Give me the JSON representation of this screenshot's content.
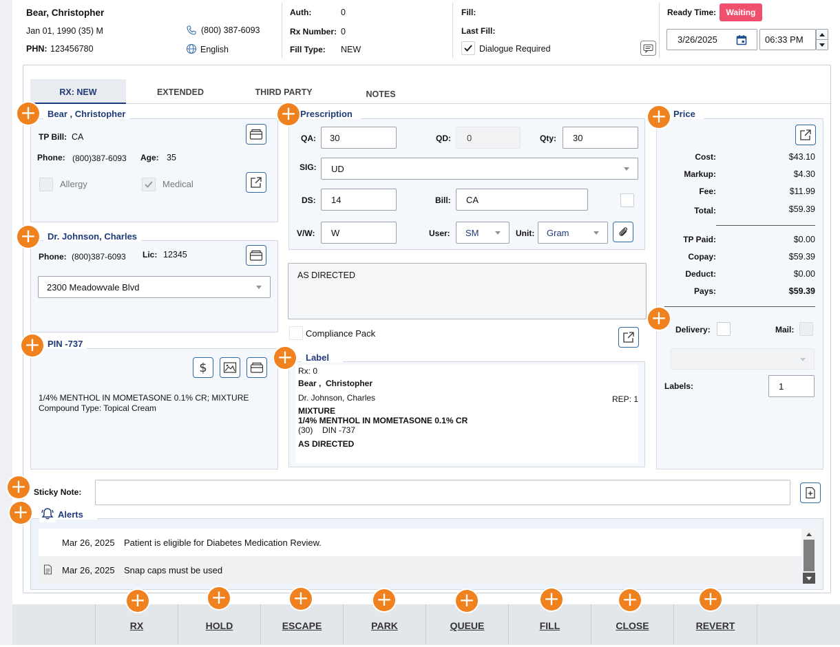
{
  "patient": {
    "name": "Bear, Christopher",
    "dob": "Jan 01, 1990 (35) M",
    "phn_label": "PHN:",
    "phn": "123456780",
    "phone": "(800) 387-6093",
    "language": "English"
  },
  "auth": {
    "auth_label": "Auth:",
    "auth": "0",
    "rx_label": "Rx Number:",
    "rx": "0",
    "filltype_label": "Fill Type:",
    "filltype": "NEW"
  },
  "fill": {
    "fill_label": "Fill:",
    "lastfill_label": "Last Fill:",
    "dialogue_label": "Dialogue Required"
  },
  "ready": {
    "label": "Ready Time:",
    "status": "Waiting",
    "date": "3/26/2025",
    "time": "06:33 PM"
  },
  "tabs": [
    "RX: NEW",
    "EXTENDED",
    "THIRD PARTY",
    "NOTES"
  ],
  "patient_panel": {
    "title": "Bear , Christopher",
    "tpbill_label": "TP Bill:",
    "tpbill": "CA",
    "phone_label": "Phone:",
    "phone": "(800)387-6093",
    "age_label": "Age:",
    "age": "35",
    "allergy": "Allergy",
    "medical": "Medical"
  },
  "doctor_panel": {
    "title": "Dr. Johnson, Charles",
    "phone_label": "Phone:",
    "phone": "(800)387-6093",
    "lic_label": "Lic:",
    "lic": "12345",
    "address": "2300 Meadowvale Blvd"
  },
  "pin_panel": {
    "title": "PIN -737",
    "desc": "1/4% MENTHOL IN MOMETASONE 0.1% CR; MIXTURE",
    "compound": "Compound Type: Topical Cream"
  },
  "prescription": {
    "title": "Prescription",
    "qa_label": "QA:",
    "qa": "30",
    "qd_label": "QD:",
    "qd": "0",
    "qty_label": "Qty:",
    "qty": "30",
    "sig_label": "SIG:",
    "sig": "UD",
    "ds_label": "DS:",
    "ds": "14",
    "bill_label": "Bill:",
    "bill": "CA",
    "vw_label": "V/W:",
    "vw": "W",
    "user_label": "User:",
    "user": "SM",
    "unit_label": "Unit:",
    "unit": "Gram",
    "directions": "AS DIRECTED",
    "compliance": "Compliance Pack"
  },
  "label": {
    "title": "Label",
    "rx": "Rx: 0",
    "patient": "Bear ,  Christopher",
    "doctor": "Dr. Johnson, Charles",
    "rep": "REP: 1",
    "line1": "MIXTURE",
    "line2": "1/4% MENTHOL IN MOMETASONE 0.1% CR",
    "qty": "(30)",
    "din": "DIN -737",
    "directions": "AS DIRECTED"
  },
  "price": {
    "title": "Price",
    "rows1": [
      {
        "label": "Cost:",
        "value": "$43.10"
      },
      {
        "label": "Markup:",
        "value": "$4.30"
      },
      {
        "label": "Fee:",
        "value": "$11.99"
      },
      {
        "label": "Total:",
        "value": "$59.39"
      }
    ],
    "rows2": [
      {
        "label": "TP Paid:",
        "value": "$0.00"
      },
      {
        "label": "Copay:",
        "value": "$59.39"
      },
      {
        "label": "Deduct:",
        "value": "$0.00"
      },
      {
        "label": "Pays:",
        "value": "$59.39"
      }
    ],
    "delivery": "Delivery:",
    "mail": "Mail:",
    "labels_label": "Labels:",
    "labels": "1"
  },
  "sticky": {
    "label": "Sticky Note:"
  },
  "alerts": {
    "title": "Alerts",
    "items": [
      {
        "date": "Mar 26, 2025",
        "text": "Patient is eligible for Diabetes Medication Review."
      },
      {
        "date": "Mar 26, 2025",
        "text": "Snap caps must be used"
      }
    ]
  },
  "buttons": [
    "RX",
    "HOLD",
    "ESCAPE",
    "PARK",
    "QUEUE",
    "FILL",
    "CLOSE",
    "REVERT"
  ],
  "colors": {
    "accent": "#f0811f",
    "navy": "#1f3a7a",
    "waiting": "#f0506e",
    "icon_blue": "#2f6aa8"
  }
}
